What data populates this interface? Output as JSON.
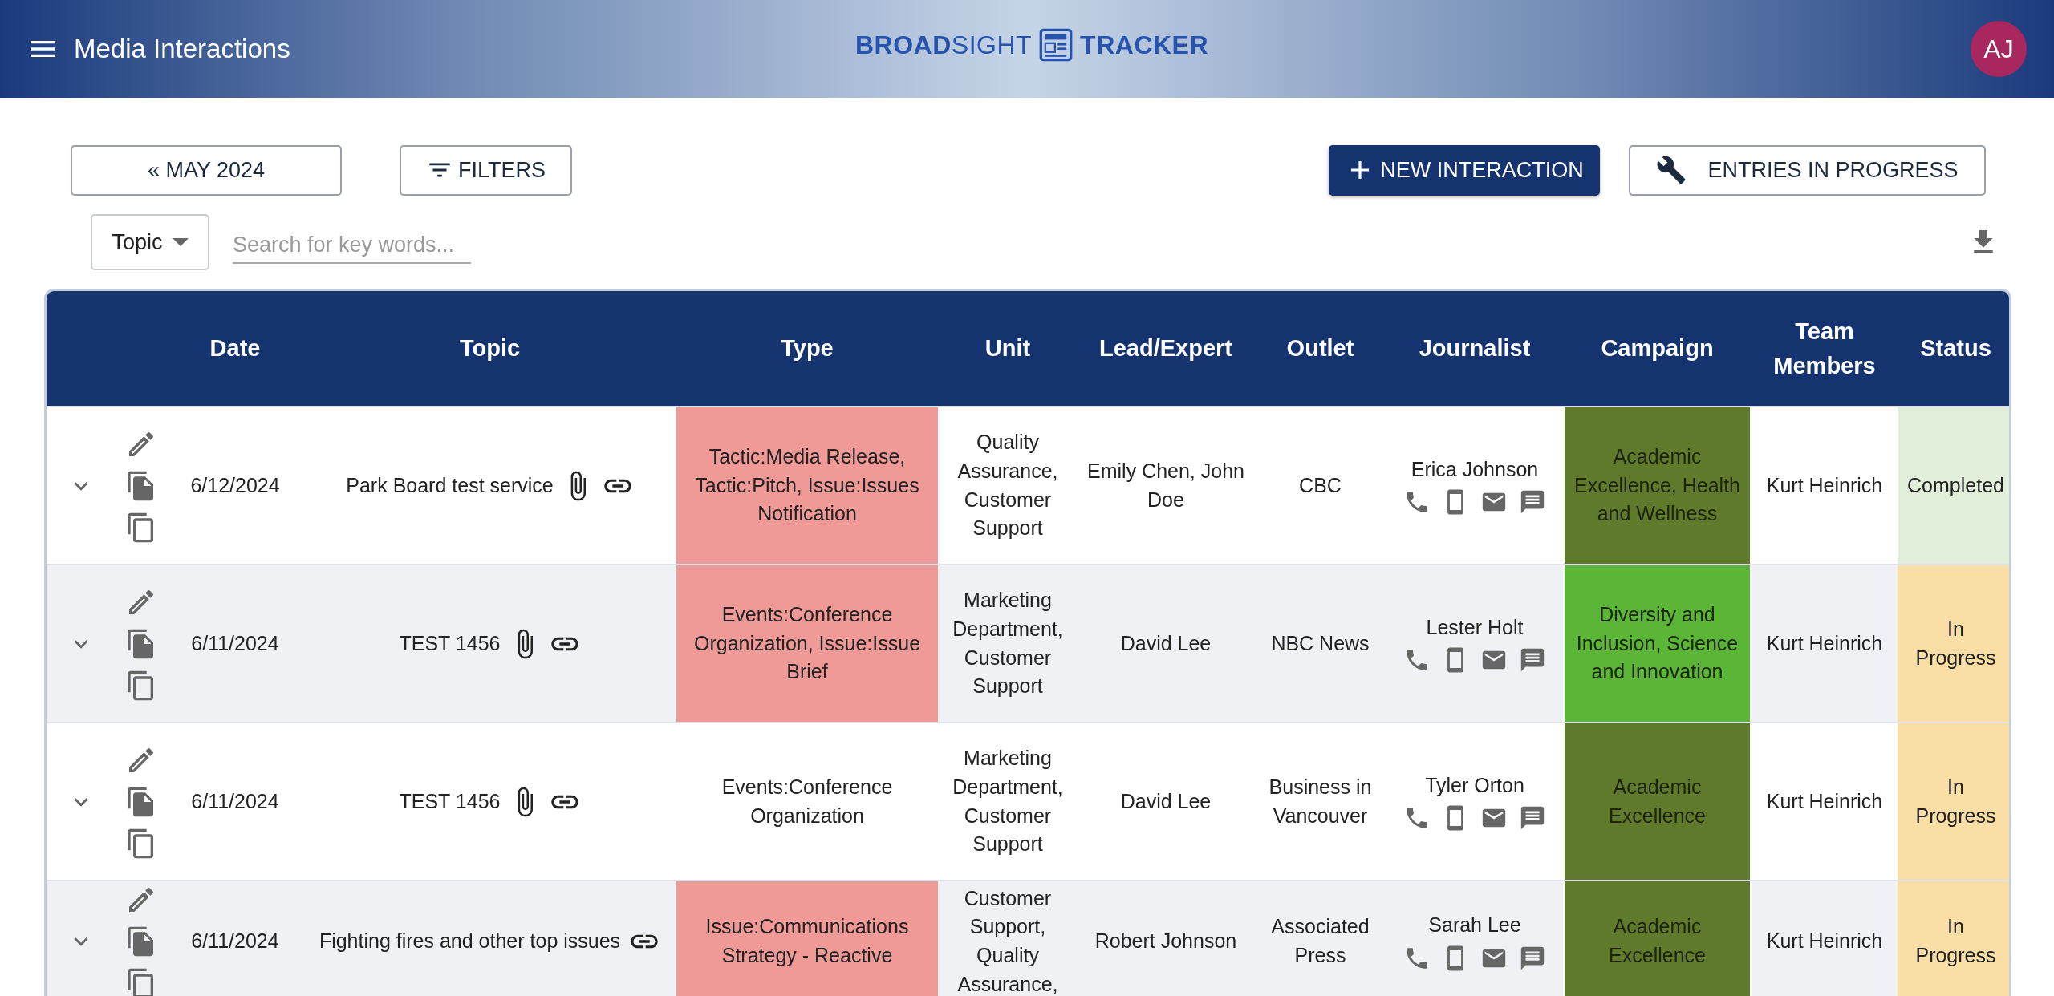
{
  "header": {
    "title": "Media Interactions",
    "logo": {
      "part_1": "BROAD",
      "part_2": "SIGHT",
      "part_3": "TRACKER"
    },
    "avatar": "AJ"
  },
  "toolbar": {
    "month_button": "« MAY 2024",
    "filters_button": "FILTERS",
    "new_button": "NEW INTERACTION",
    "progress_button": "ENTRIES IN PROGRESS"
  },
  "search": {
    "field_select": "Topic",
    "placeholder": "Search for key words..."
  },
  "table": {
    "columns": [
      "Date",
      "Topic",
      "Type",
      "Unit",
      "Lead/Expert",
      "Outlet",
      "Journalist",
      "Campaign",
      "Team Members",
      "Status"
    ],
    "rows": [
      {
        "date": "6/12/2024",
        "topic": "Park Board test service",
        "has_attachment": true,
        "has_link": true,
        "type": "Tactic:Media Release, Tactic:Pitch, Issue:Issues Notification",
        "type_highlighted": true,
        "unit": "Quality Assurance, Customer Support",
        "lead": "Emily Chen, John Doe",
        "outlet": "CBC",
        "journalist": "Erica Johnson",
        "campaign": {
          "text": "Academic Excellence, Health and Wellness",
          "color": "#5f7a2b"
        },
        "team": "Kurt Heinrich",
        "status": {
          "text": "Completed",
          "color": "#e1eeda"
        }
      },
      {
        "date": "6/11/2024",
        "topic": "TEST 1456",
        "has_attachment": true,
        "has_link": true,
        "type": "Events:Conference Organization, Issue:Issue Brief",
        "type_highlighted": true,
        "unit": "Marketing Department, Customer Support",
        "lead": "David Lee",
        "outlet": "NBC News",
        "journalist": "Lester Holt",
        "campaign": {
          "text": "Diversity and Inclusion, Science and Innovation",
          "color": "#5bb536"
        },
        "team": "Kurt Heinrich",
        "status": {
          "text": "In Progress",
          "color": "#f9dea5"
        }
      },
      {
        "date": "6/11/2024",
        "topic": "TEST 1456",
        "has_attachment": true,
        "has_link": true,
        "type": "Events:Conference Organization",
        "type_highlighted": false,
        "unit": "Marketing Department, Customer Support",
        "lead": "David Lee",
        "outlet": "Business in Vancouver",
        "journalist": "Tyler Orton",
        "campaign": {
          "text": "Academic Excellence",
          "color": "#5f7a2b"
        },
        "team": "Kurt Heinrich",
        "status": {
          "text": "In Progress",
          "color": "#f9dea5"
        }
      },
      {
        "date": "6/11/2024",
        "topic": "Fighting fires and other top issues",
        "has_attachment": false,
        "has_link": true,
        "type": "Issue:Communications Strategy - Reactive",
        "type_highlighted": true,
        "unit": "Customer Support, Quality Assurance,",
        "lead": "Robert Johnson",
        "outlet": "Associated Press",
        "journalist": "Sarah Lee",
        "campaign": {
          "text": "Academic Excellence",
          "color": "#5f7a2b"
        },
        "team": "Kurt Heinrich",
        "status": {
          "text": "In Progress",
          "color": "#f9dea5"
        }
      }
    ]
  }
}
